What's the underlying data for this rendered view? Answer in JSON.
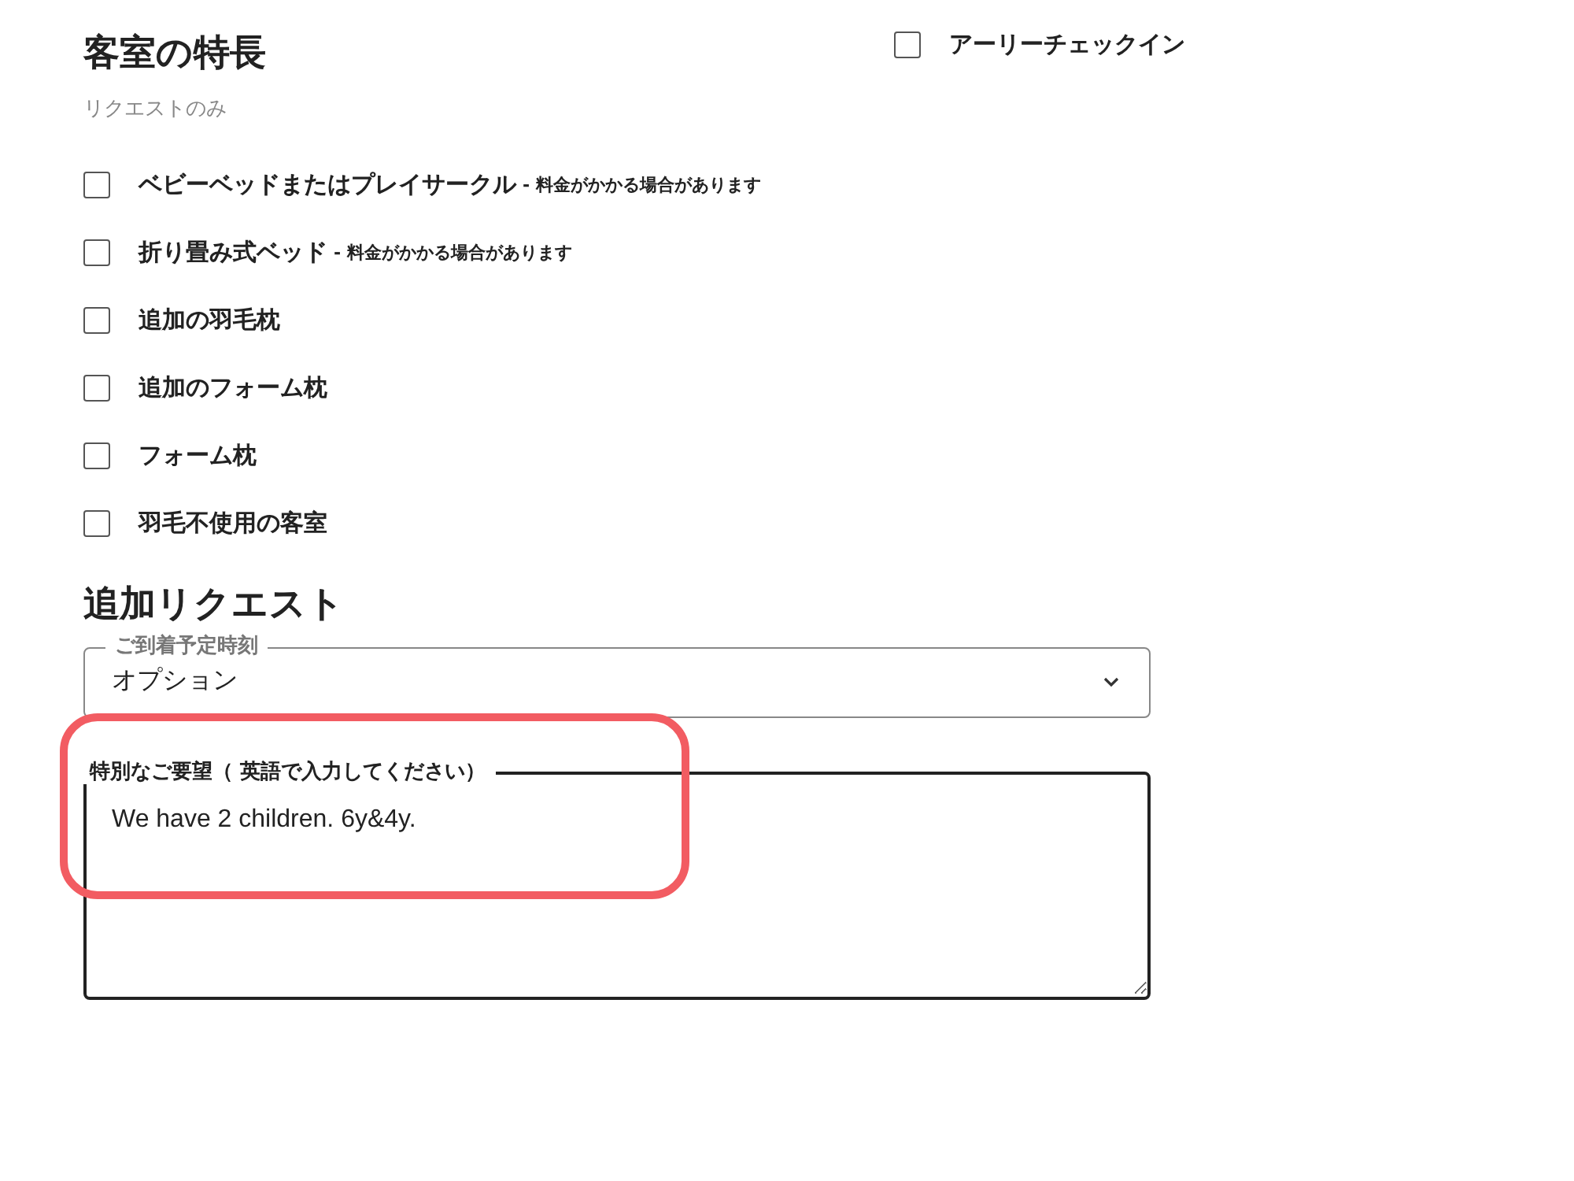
{
  "room_features": {
    "title": "客室の特長",
    "subtitle": "リクエストのみ",
    "options": [
      {
        "label": "ベビーベッドまたはプレイサークル",
        "note": "- 料金がかかる場合があります",
        "checked": false
      },
      {
        "label": "折り畳み式ベッド",
        "note": "- 料金がかかる場合があります",
        "checked": false
      },
      {
        "label": "追加の羽毛枕",
        "checked": false
      },
      {
        "label": "追加のフォーム枕",
        "checked": false
      },
      {
        "label": "フォーム枕",
        "checked": false
      },
      {
        "label": "羽毛不使用の客室",
        "checked": false
      }
    ]
  },
  "early_checkin": {
    "label": "アーリーチェックイン",
    "checked": false
  },
  "additional_requests": {
    "title": "追加リクエスト",
    "arrival_time": {
      "label": "ご到着予定時刻",
      "value": "オプション"
    },
    "special_requests": {
      "label": "特別なご要望（ 英語で入力してください）",
      "value": "We have 2 children. 6y&4y.",
      "highlighted": true
    }
  }
}
